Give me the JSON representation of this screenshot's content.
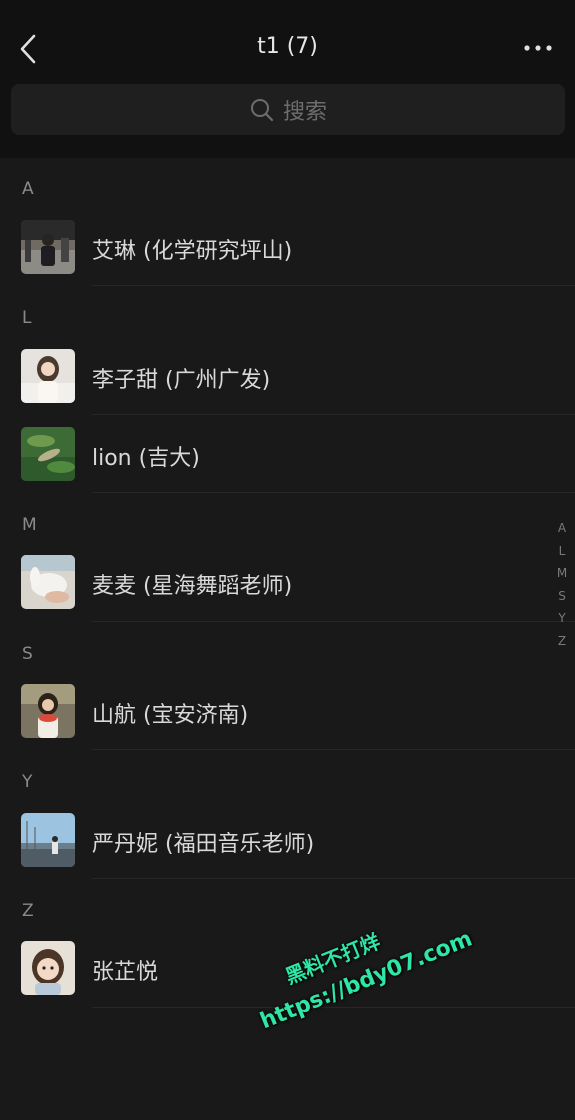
{
  "header": {
    "title": "t1 (7)"
  },
  "search": {
    "placeholder": "搜索"
  },
  "sections": [
    {
      "letter": "A",
      "contacts": [
        {
          "name": "艾琳 (化学研究坪山)"
        }
      ]
    },
    {
      "letter": "L",
      "contacts": [
        {
          "name": "李子甜 (广州广发)"
        },
        {
          "name": "lion (吉大)"
        }
      ]
    },
    {
      "letter": "M",
      "contacts": [
        {
          "name": "麦麦 (星海舞蹈老师)"
        }
      ]
    },
    {
      "letter": "S",
      "contacts": [
        {
          "name": "山航 (宝安济南)"
        }
      ]
    },
    {
      "letter": "Y",
      "contacts": [
        {
          "name": "严丹妮 (福田音乐老师)"
        }
      ]
    },
    {
      "letter": "Z",
      "contacts": [
        {
          "name": "张芷悦"
        }
      ]
    }
  ],
  "index_bar": [
    "A",
    "L",
    "M",
    "S",
    "Y",
    "Z"
  ],
  "watermark": {
    "line1": "黑料不打烊",
    "line2": "https://bdy07.com",
    "color": "#2ee6a6"
  }
}
